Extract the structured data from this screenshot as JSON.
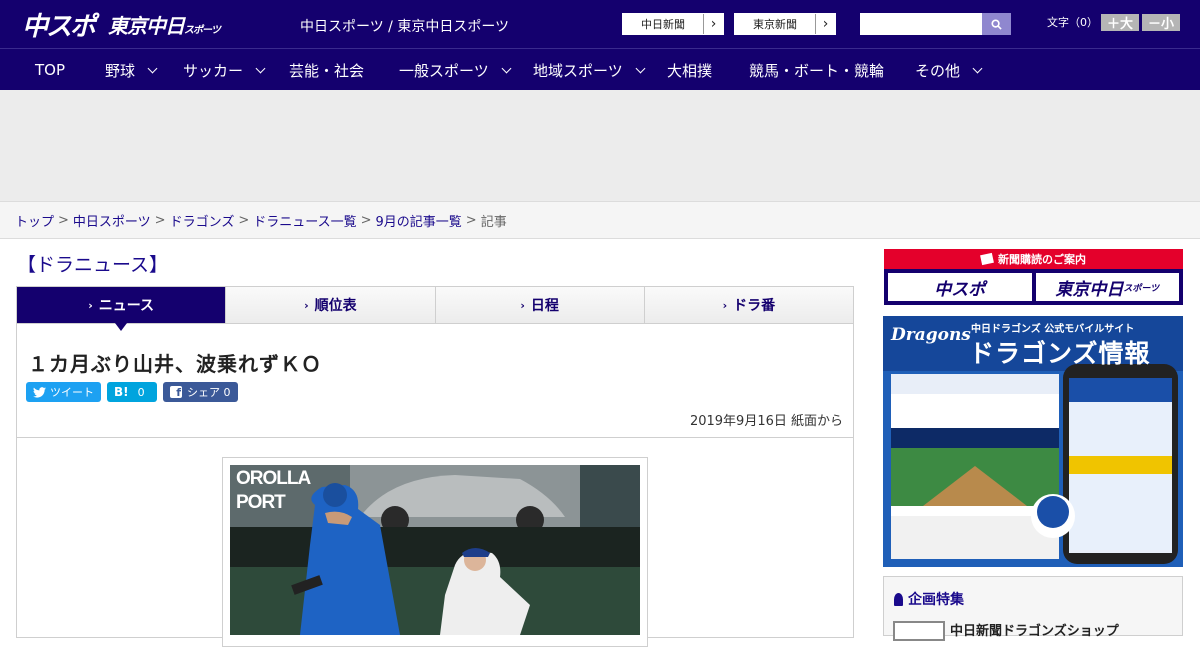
{
  "header": {
    "logo_main": "中スポ",
    "logo_tokyo": "東京中日",
    "logo_tokyo_small": "スポーツ",
    "site_title": "中日スポーツ / 東京中日スポーツ",
    "btn_chunichi": "中日新聞",
    "btn_tokyo": "東京新聞",
    "search_placeholder": "",
    "font_label": "文字（0）",
    "font_bigger": "＋大",
    "font_smaller": "－小"
  },
  "nav": {
    "items": [
      {
        "label": "TOP"
      },
      {
        "label": "野球"
      },
      {
        "label": "サッカー"
      },
      {
        "label": "芸能・社会"
      },
      {
        "label": "一般スポーツ"
      },
      {
        "label": "地域スポーツ"
      },
      {
        "label": "大相撲"
      },
      {
        "label": "競馬・ボート・競輪"
      },
      {
        "label": "その他"
      }
    ]
  },
  "breadcrumb": {
    "items": [
      "トップ",
      "中日スポーツ",
      "ドラゴンズ",
      "ドラニュース一覧",
      "9月の記事一覧"
    ],
    "current": "記事",
    "separator": ">"
  },
  "main": {
    "section_title": "【ドラニュース】",
    "tabs": [
      {
        "label": "ニュース"
      },
      {
        "label": "順位表"
      },
      {
        "label": "日程"
      },
      {
        "label": "ドラ番"
      }
    ],
    "headline": "１カ月ぶり山井、波乗れずＫＯ",
    "share": {
      "tweet": "ツイート",
      "hatena": "0",
      "facebook": "シェア 0"
    },
    "date": "2019年9月16日 紙面から",
    "photo_text": "OROLLA PORT"
  },
  "sidebar": {
    "subscribe_title": "新聞購読のご案内",
    "sub_btn1": "中スポ",
    "sub_btn2": "東京中日",
    "sub_btn2_small": "スポーツ",
    "dragons_logo": "Dragons",
    "dragons_sub": "中日ドラゴンズ 公式モバイルサイト",
    "dragons_title": "ドラゴンズ情報",
    "feature_title": "企画特集",
    "feature_item": "中日新聞ドラゴンズショップ"
  },
  "colors": {
    "brand": "#14006e",
    "accent_red": "#e4002b",
    "twitter": "#1da1f2",
    "hatena": "#00a4de",
    "facebook": "#3b5998"
  }
}
